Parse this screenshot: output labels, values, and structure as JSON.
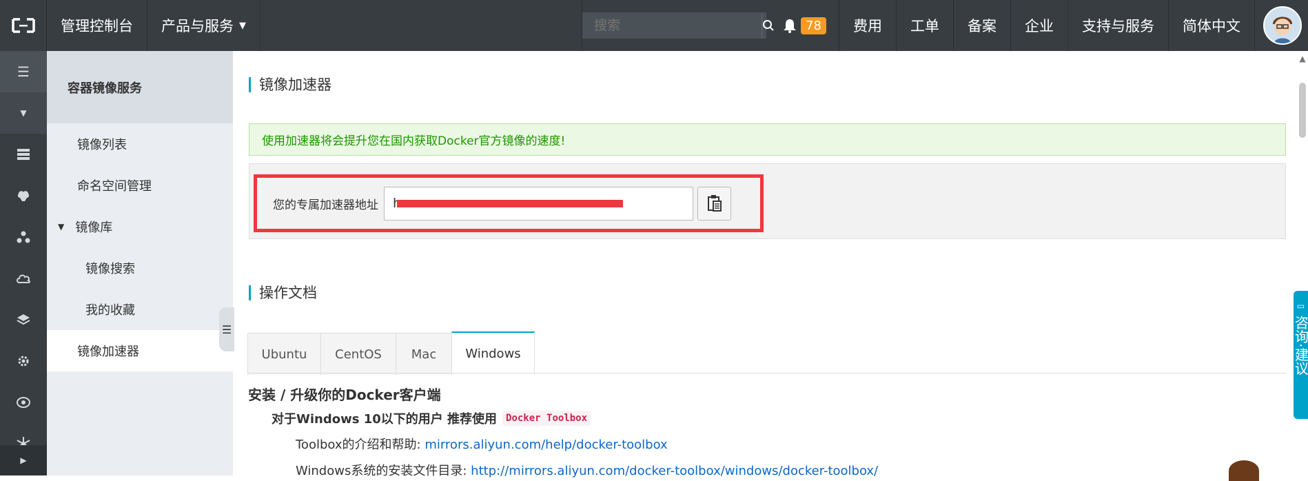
{
  "topbar": {
    "console": "管理控制台",
    "products": "产品与服务",
    "search_placeholder": "搜索",
    "notification_count": "78",
    "links": [
      "费用",
      "工单",
      "备案",
      "企业",
      "支持与服务",
      "简体中文"
    ]
  },
  "subnav": {
    "title": "容器镜像服务",
    "items": [
      "镜像列表",
      "命名空间管理",
      "镜像库",
      "镜像搜索",
      "我的收藏",
      "镜像加速器"
    ]
  },
  "main": {
    "title": "镜像加速器",
    "notice": "使用加速器将会提升您在国内获取Docker官方镜像的速度!",
    "address_label": "您的专属加速器地址",
    "address_value": "h",
    "docs_title": "操作文档",
    "tabs": [
      "Ubuntu",
      "CentOS",
      "Mac",
      "Windows"
    ],
    "active_tab": "Windows",
    "doc_heading": "安装 / 升级你的Docker客户端",
    "doc_sub": "对于Windows 10以下的用户 推荐使用",
    "doc_code": "Docker Toolbox",
    "line1_text": "Toolbox的介绍和帮助:",
    "line1_link": "mirrors.aliyun.com/help/docker-toolbox",
    "line2_text": "Windows系统的安装文件目录:",
    "line2_link": "http://mirrors.aliyun.com/docker-toolbox/windows/docker-toolbox/"
  },
  "consult": "咨询·建议",
  "colors": {
    "accent": "#00a2ca",
    "topbar": "#373d41",
    "highlight": "#f0373d",
    "badge": "#f59a23"
  }
}
